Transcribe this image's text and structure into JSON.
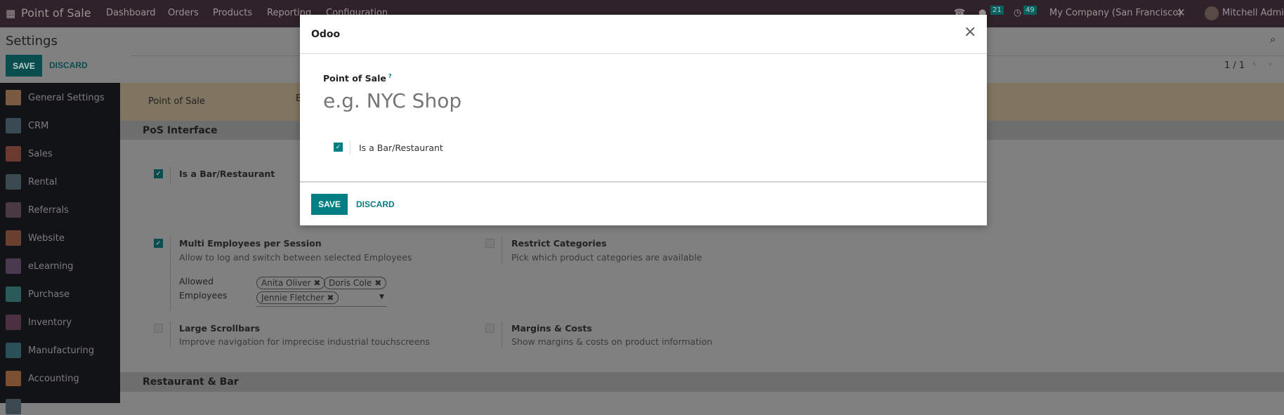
{
  "topbar": {
    "app": "Point of Sale",
    "menu": [
      "Dashboard",
      "Orders",
      "Products",
      "Reporting",
      "Configuration"
    ],
    "messages_count": "21",
    "activities_count": "49",
    "company": "My Company (San Francisco)",
    "user": "Mitchell Admin"
  },
  "control_panel": {
    "title": "Settings",
    "save": "SAVE",
    "discard": "DISCARD",
    "pager": "1 / 1"
  },
  "sidebar": {
    "items": [
      {
        "label": "General Settings",
        "color": "#7a5a40"
      },
      {
        "label": "CRM",
        "color": "#3a4a55"
      },
      {
        "label": "Sales",
        "color": "#6a3a30"
      },
      {
        "label": "Rental",
        "color": "#3a4a50"
      },
      {
        "label": "Referrals",
        "color": "#4a3a45"
      },
      {
        "label": "Website",
        "color": "#6a4030"
      },
      {
        "label": "eLearning",
        "color": "#4a3a50"
      },
      {
        "label": "Purchase",
        "color": "#2a5a5a"
      },
      {
        "label": "Inventory",
        "color": "#4a3040"
      },
      {
        "label": "Manufacturing",
        "color": "#2a5058"
      },
      {
        "label": "Accounting",
        "color": "#7a5030"
      },
      {
        "label": "",
        "color": "#3a4a50"
      }
    ]
  },
  "band": {
    "label": "Point of Sale",
    "value": "B"
  },
  "sections": {
    "pos_interface": "PoS Interface",
    "restaurant_bar": "Restaurant & Bar"
  },
  "settings": {
    "bar": {
      "title": "Is a Bar/Restaurant",
      "checked": true
    },
    "multi": {
      "title": "Multi Employees per Session",
      "desc": "Allow to log and switch between selected Employees",
      "checked": true,
      "allowed_label_1": "Allowed",
      "allowed_label_2": "Employees",
      "employees": [
        "Anita Oliver",
        "Doris Cole",
        "Jennie Fletcher"
      ]
    },
    "restrict": {
      "title": "Restrict Categories",
      "desc": "Pick which product categories are available",
      "checked": false
    },
    "scroll": {
      "title": "Large Scrollbars",
      "desc": "Improve navigation for imprecise industrial touchscreens",
      "checked": false
    },
    "margins": {
      "title": "Margins & Costs",
      "desc": "Show margins & costs on product information",
      "checked": false
    }
  },
  "modal": {
    "title": "Odoo",
    "field_label": "Point of Sale",
    "help": "?",
    "placeholder": "e.g. NYC Shop",
    "checkbox_label": "Is a Bar/Restaurant",
    "checked": true,
    "save": "SAVE",
    "discard": "DISCARD"
  }
}
